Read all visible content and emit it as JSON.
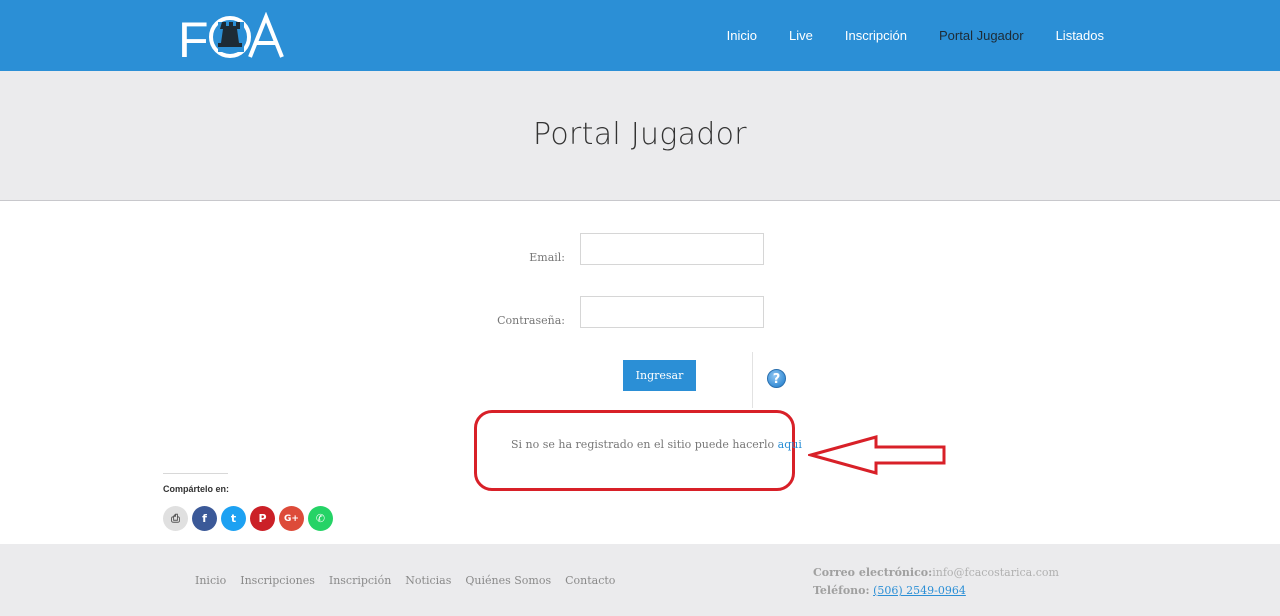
{
  "header": {
    "logo_text": "FCA",
    "nav": [
      "Inicio",
      "Live",
      "Inscripción",
      "Portal Jugador",
      "Listados"
    ],
    "active_index": 3,
    "bg_color": "#2b8fd6"
  },
  "page": {
    "title": "Portal Jugador"
  },
  "form": {
    "email_label": "Email:",
    "email_value": "",
    "password_label": "Contraseña:",
    "password_value": "",
    "submit_label": "Ingresar",
    "help_icon": "question-icon",
    "help_glyph": "?"
  },
  "register": {
    "text": "Si no se ha registrado en el sitio puede hacerlo ",
    "link": "aqui"
  },
  "share": {
    "label": "Compártelo en:",
    "buttons": [
      {
        "icon": "print-icon",
        "glyph": "⎙",
        "color": "#e0e0e0"
      },
      {
        "icon": "facebook-icon",
        "glyph": "f",
        "color": "#3b5998"
      },
      {
        "icon": "twitter-icon",
        "glyph": "t",
        "color": "#1da1f2"
      },
      {
        "icon": "pinterest-icon",
        "glyph": "P",
        "color": "#cb2027"
      },
      {
        "icon": "google-plus-icon",
        "glyph": "G+",
        "color": "#dd4b39"
      },
      {
        "icon": "whatsapp-icon",
        "glyph": "✆",
        "color": "#25d366"
      }
    ]
  },
  "footer": {
    "links": [
      "Inicio",
      "Inscripciones",
      "Inscripción",
      "Noticias",
      "Quiénes Somos",
      "Contacto"
    ],
    "email_label": "Correo electrónico:",
    "email_value": "info@fcacostarica.com",
    "phone_label": "Teléfono:",
    "phone_value": "(506) 2549-0964"
  }
}
